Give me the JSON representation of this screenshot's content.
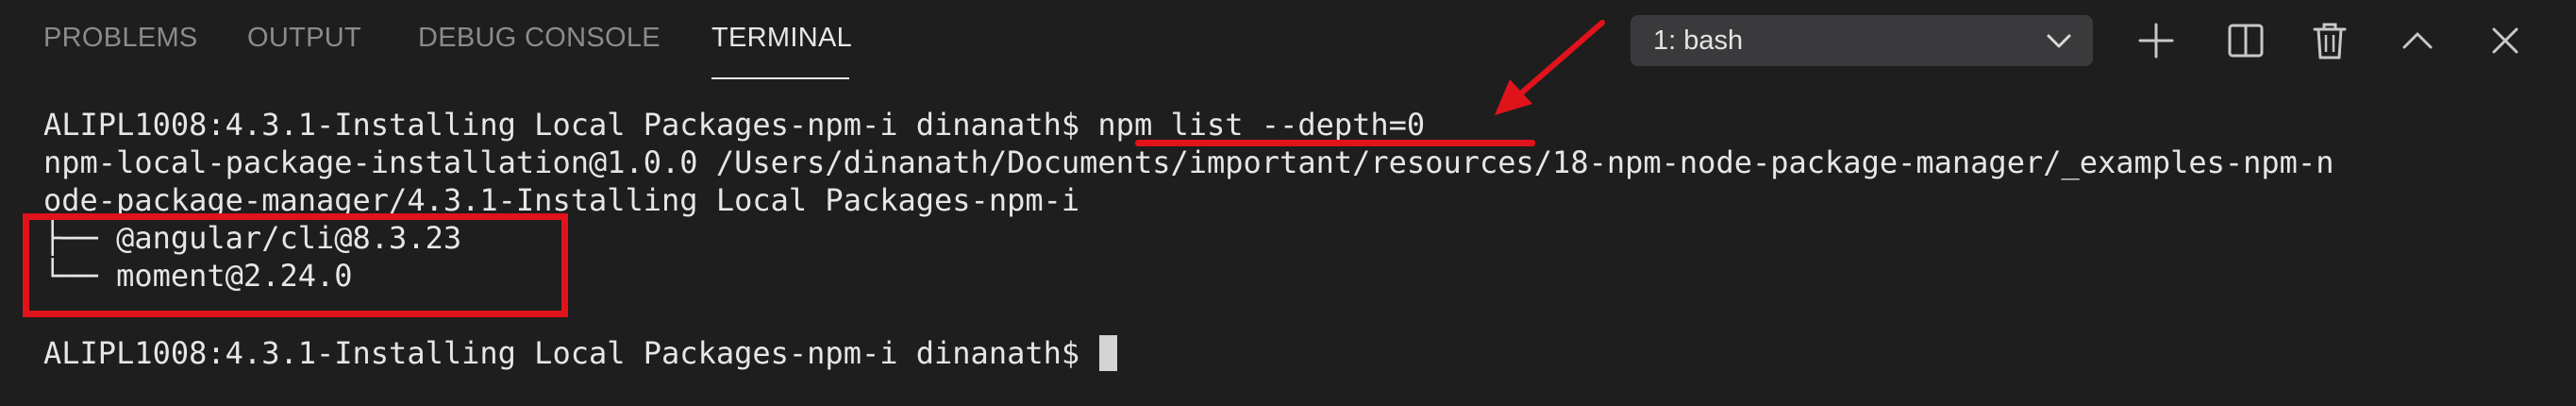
{
  "panel": {
    "tabs": [
      {
        "label": "PROBLEMS",
        "active": false
      },
      {
        "label": "OUTPUT",
        "active": false
      },
      {
        "label": "DEBUG CONSOLE",
        "active": false
      },
      {
        "label": "TERMINAL",
        "active": true
      }
    ],
    "terminal_select": {
      "value": "1: bash",
      "icon": "chevron-down-icon"
    },
    "actions": [
      {
        "name": "new-terminal",
        "icon": "plus-icon"
      },
      {
        "name": "split-terminal",
        "icon": "split-icon"
      },
      {
        "name": "kill-terminal",
        "icon": "trash-icon"
      },
      {
        "name": "maximize-panel",
        "icon": "chevron-up-icon"
      },
      {
        "name": "close-panel",
        "icon": "close-icon"
      }
    ]
  },
  "terminal": {
    "line1_prompt": "ALIPL1008:4.3.1-Installing Local Packages-npm-i dinanath$ ",
    "line1_command": "npm list --depth=0",
    "line2": "npm-local-package-installation@1.0.0 /Users/dinanath/Documents/important/resources/18-npm-node-package-manager/_examples-npm-n",
    "line3": "ode-package-manager/4.3.1-Installing Local Packages-npm-i",
    "line4": "├── @angular/cli@8.3.23",
    "line5": "└── moment@2.24.0",
    "line6_prompt": "ALIPL1008:4.3.1-Installing Local Packages-npm-i dinanath$ "
  },
  "colors": {
    "background": "#1e1e1e",
    "text": "#e6e6e6",
    "tab_inactive": "#8b8b8b",
    "tab_active": "#e7e7e7",
    "annotation": "#e0131b"
  }
}
